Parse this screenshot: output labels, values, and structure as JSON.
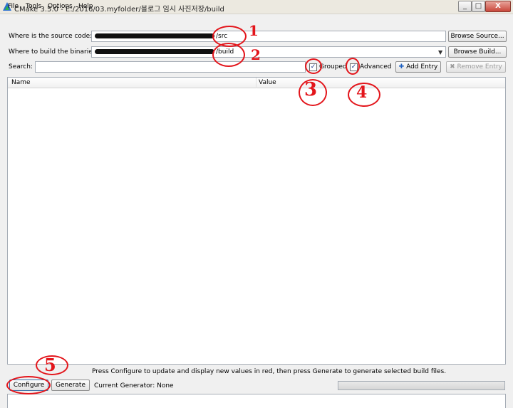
{
  "window": {
    "title": "CMake 3.5.0 - E:/2016/03.myfolder/블로그 임시 사진저장/build",
    "minimize_glyph": "_",
    "maximize_glyph": "□",
    "close_glyph": "X"
  },
  "menu": [
    "File",
    "Tools",
    "Options",
    "Help"
  ],
  "source": {
    "label": "Where is the source code:",
    "value_suffix": "/src",
    "browse_label": "Browse Source..."
  },
  "binaries": {
    "label": "Where to build the binaries:",
    "value_suffix": "/build",
    "browse_label": "Browse Build..."
  },
  "search": {
    "label": "Search:",
    "value": ""
  },
  "options": {
    "grouped_label": "Grouped",
    "grouped_checked": true,
    "advanced_label": "Advanced",
    "advanced_checked": true,
    "add_entry_label": "Add Entry",
    "remove_entry_label": "Remove Entry"
  },
  "table": {
    "columns": [
      "Name",
      "Value"
    ],
    "rows": []
  },
  "hint": "Press Configure to update and display new values in red, then press Generate to generate selected build files.",
  "actions": {
    "configure_label": "Configure",
    "generate_label": "Generate",
    "current_generator": "Current Generator: None"
  },
  "progress": 0,
  "annotations": [
    "1",
    "2",
    "3",
    "4",
    "5"
  ],
  "colors": {
    "annotation": "#e3151b",
    "accent": "#2a6fd1"
  },
  "icons": {
    "app": "cmake-triangle-icon",
    "add": "plus-icon",
    "remove": "cross-icon",
    "check": "checkmark-icon"
  }
}
